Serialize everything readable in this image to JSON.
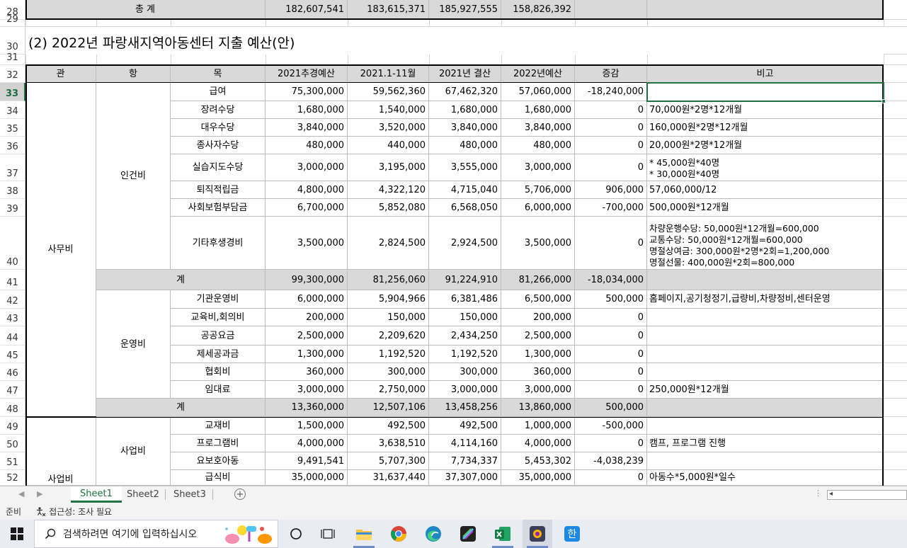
{
  "title": "(2) 2022년 파랑새지역아동센터 지출 예산(안)",
  "top_total": {
    "row": "28",
    "label": "총      계",
    "values": [
      "182,607,541",
      "183,615,371",
      "185,927,555",
      "158,826,392",
      "",
      ""
    ]
  },
  "header": {
    "row": "32",
    "columns": [
      "관",
      "항",
      "목",
      "2021추경예산",
      "2021.1-11월",
      "2021년 결산",
      "2022년예산",
      "증감",
      "비고"
    ]
  },
  "group_labels": {
    "gwan_office": "사무비",
    "gwan_project": "사업비",
    "hang_personnel": "인건비",
    "hang_operation": "운영비",
    "hang_project": "사업비"
  },
  "rows": [
    {
      "row": "33",
      "mok": "급여",
      "v": [
        "75,300,000",
        "59,562,360",
        "67,462,320",
        "57,060,000",
        "-18,240,000"
      ],
      "note": ""
    },
    {
      "row": "34",
      "mok": "장려수당",
      "v": [
        "1,680,000",
        "1,540,000",
        "1,680,000",
        "1,680,000",
        "0"
      ],
      "note": "70,000원*2명*12개월"
    },
    {
      "row": "35",
      "mok": "대우수당",
      "v": [
        "3,840,000",
        "3,520,000",
        "3,840,000",
        "3,840,000",
        "0"
      ],
      "note": "160,000원*2명*12개월"
    },
    {
      "row": "36",
      "mok": "종사자수당",
      "v": [
        "480,000",
        "440,000",
        "480,000",
        "480,000",
        "0"
      ],
      "note": "20,000원*2명*12개월"
    },
    {
      "row": "37",
      "mok": "실습지도수당",
      "v": [
        "3,000,000",
        "3,195,000",
        "3,555,000",
        "3,000,000",
        "0"
      ],
      "note": "* 45,000원*40명\n* 30,000원*40명"
    },
    {
      "row": "38",
      "mok": "퇴직적립금",
      "v": [
        "4,800,000",
        "4,322,120",
        "4,715,040",
        "5,706,000",
        "906,000"
      ],
      "note": "57,060,000/12"
    },
    {
      "row": "39",
      "mok": "사회보험부담금",
      "v": [
        "6,700,000",
        "5,852,080",
        "6,568,050",
        "6,000,000",
        "-700,000"
      ],
      "note": "500,000원*12개월"
    },
    {
      "row": "40",
      "mok": "기타후생경비",
      "v": [
        "3,500,000",
        "2,824,500",
        "2,924,500",
        "3,500,000",
        "0"
      ],
      "note": "차량운행수당: 50,000원*12개월=600,000\n교통수당: 50,000원*12개월=600,000\n명절상여금: 300,000원*2명*2회=1,200,000\n명절선물: 400,000원*2회=800,000"
    },
    {
      "row": "41",
      "mok": "계",
      "subtotal": true,
      "v": [
        "99,300,000",
        "81,256,060",
        "91,224,910",
        "81,266,000",
        "-18,034,000"
      ],
      "note": ""
    },
    {
      "row": "42",
      "mok": "기관운영비",
      "v": [
        "6,000,000",
        "5,904,966",
        "6,381,486",
        "6,500,000",
        "500,000"
      ],
      "note": "홈페이지,공기청정기,급량비,차량정비,센터운영"
    },
    {
      "row": "43",
      "mok": "교육비,회의비",
      "v": [
        "200,000",
        "150,000",
        "150,000",
        "200,000",
        "0"
      ],
      "note": ""
    },
    {
      "row": "44",
      "mok": "공공요금",
      "v": [
        "2,500,000",
        "2,209,620",
        "2,434,250",
        "2,500,000",
        "0"
      ],
      "note": ""
    },
    {
      "row": "45",
      "mok": "제세공과금",
      "v": [
        "1,300,000",
        "1,192,520",
        "1,192,520",
        "1,300,000",
        "0"
      ],
      "note": ""
    },
    {
      "row": "46",
      "mok": "협회비",
      "v": [
        "360,000",
        "300,000",
        "300,000",
        "360,000",
        "0"
      ],
      "note": ""
    },
    {
      "row": "47",
      "mok": "임대료",
      "v": [
        "3,000,000",
        "2,750,000",
        "3,000,000",
        "3,000,000",
        "0"
      ],
      "note": "250,000원*12개월"
    },
    {
      "row": "48",
      "mok": "계",
      "subtotal": true,
      "v": [
        "13,360,000",
        "12,507,106",
        "13,458,256",
        "13,860,000",
        "500,000"
      ],
      "note": ""
    },
    {
      "row": "49",
      "mok": "교재비",
      "v": [
        "1,500,000",
        "492,500",
        "492,500",
        "1,000,000",
        "-500,000"
      ],
      "note": ""
    },
    {
      "row": "50",
      "mok": "프로그램비",
      "v": [
        "4,000,000",
        "3,638,510",
        "4,114,160",
        "4,000,000",
        "0"
      ],
      "note": "캠프, 프로그램 진행"
    },
    {
      "row": "51",
      "mok": "요보호아동",
      "v": [
        "9,491,541",
        "5,707,300",
        "7,734,337",
        "5,453,302",
        "-4,038,239"
      ],
      "note": ""
    },
    {
      "row": "52",
      "mok": "급식비",
      "v": [
        "35,000,000",
        "31,637,440",
        "37,307,000",
        "35,000,000",
        "0"
      ],
      "note": "아동수*5,000원*일수"
    }
  ],
  "empty_rows": [
    "29",
    "31"
  ],
  "title_row": "30",
  "selected_row": "33",
  "tabs": [
    "Sheet1",
    "Sheet2",
    "Sheet3"
  ],
  "active_tab": "Sheet1",
  "status": {
    "ready": "준비",
    "accessibility": "접근성: 조사 필요"
  },
  "taskbar": {
    "search_placeholder": "검색하려면 여기에 입력하십시오",
    "apps": [
      "task-view",
      "file-explorer",
      "chrome",
      "edge",
      "app-generic",
      "excel",
      "app-viewer",
      "hangul"
    ]
  },
  "colors": {
    "excel_green": "#217346",
    "subtotal_gray": "#d9d9d9"
  }
}
